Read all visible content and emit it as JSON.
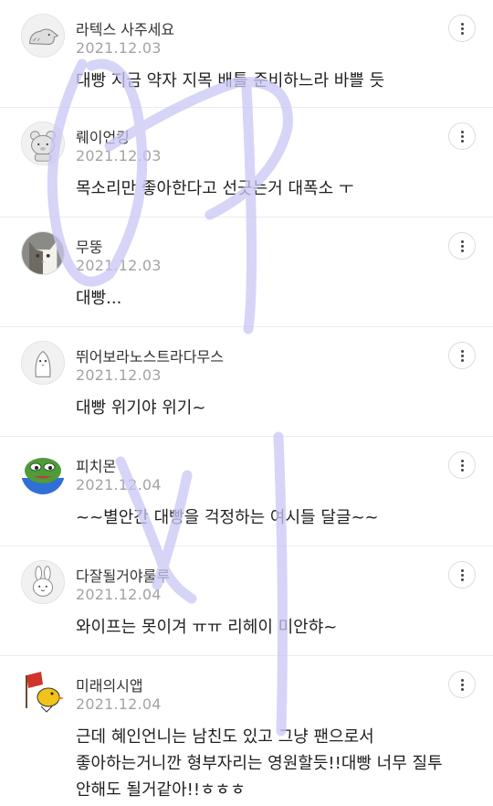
{
  "comments": [
    {
      "author": "라텍스 사주세요",
      "date": "2021.12.03",
      "text": "대빵 지금 약자 지목 배틀 준비하느라 바쁠 듯",
      "avatar_icon": "dinosaur-avatar"
    },
    {
      "author": "뤠이언킹",
      "date": "2021.12.03",
      "text": "목소리만 좋아한다고 선긋는거 대폭소 ㅜ",
      "avatar_icon": "bear-avatar"
    },
    {
      "author": "무뚱",
      "date": "2021.12.03",
      "text": "대빵...",
      "avatar_icon": "cat-photo-avatar"
    },
    {
      "author": "뛰어보라노스트라다무스",
      "date": "2021.12.03",
      "text": "대빵 위기야 위기~",
      "avatar_icon": "penguin-avatar"
    },
    {
      "author": "피치몬",
      "date": "2021.12.04",
      "text": "~~별안간 대빵을 걱정하는 여시들 달글~~",
      "avatar_icon": "frog-avatar"
    },
    {
      "author": "다잘될거야룰루",
      "date": "2021.12.04",
      "text": "와이프는 못이겨 ㅠㅠ 리헤이 미안햐~",
      "avatar_icon": "rabbit-avatar"
    },
    {
      "author": "미래의시앱",
      "date": "2021.12.04",
      "text": "근데 혜인언니는 남친도 있고 그냥 팬으로서\n좋아하는거니깐 형부자리는 영원할듯!!대빵 너무 질투\n안해도 될거같아!!ㅎㅎㅎ",
      "avatar_icon": "bird-flag-avatar"
    }
  ],
  "colors": {
    "author": "#333333",
    "date": "#a3a3a3",
    "body": "#1f1f1f",
    "divider": "#ececec",
    "watermark": "#c9c6f5"
  }
}
